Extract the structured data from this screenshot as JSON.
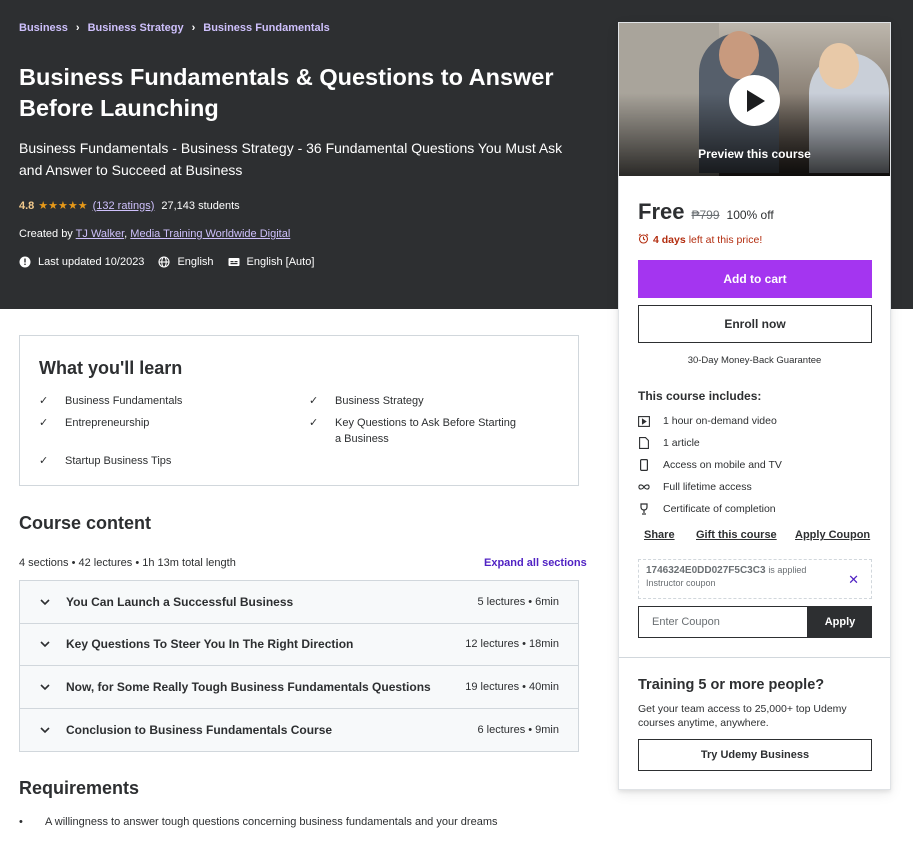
{
  "breadcrumb": [
    "Business",
    "Business Strategy",
    "Business Fundamentals"
  ],
  "course": {
    "title": "Business Fundamentals & Questions to Answer Before Launching",
    "subtitle": "Business Fundamentals - Business Strategy - 36 Fundamental Questions You Must Ask and Answer to Succeed at Business",
    "rating": "4.8",
    "stars": "★★★★★",
    "ratings_link": "(132 ratings)",
    "students": "27,143 students",
    "created_prefix": "Created by",
    "instructor1": "TJ Walker",
    "instructor_sep": ",",
    "instructor2": "Media Training Worldwide Digital",
    "last_updated": "Last updated 10/2023",
    "language": "English",
    "captions": "English [Auto]"
  },
  "learn": {
    "title": "What you'll learn",
    "items": [
      "Business Fundamentals",
      "Business Strategy",
      "Entrepreneurship",
      "Key Questions to Ask Before Starting a Business",
      "Startup Business Tips"
    ]
  },
  "content": {
    "title": "Course content",
    "meta": "4 sections • 42 lectures • 1h 13m total length",
    "expand": "Expand all sections",
    "sections": [
      {
        "name": "You Can Launch a Successful Business",
        "info": "5 lectures • 6min"
      },
      {
        "name": "Key Questions To Steer You In The Right Direction",
        "info": "12 lectures • 18min"
      },
      {
        "name": "Now, for Some Really Tough Business Fundamentals Questions",
        "info": "19 lectures • 40min"
      },
      {
        "name": "Conclusion to Business Fundamentals Course",
        "info": "6 lectures • 9min"
      }
    ]
  },
  "requirements": {
    "title": "Requirements",
    "items": [
      "A willingness to answer tough questions concerning business fundamentals and your dreams"
    ]
  },
  "sidebar": {
    "preview_label": "Preview this course",
    "price": "Free",
    "old_price": "₱799",
    "discount": "100% off",
    "timer_bold": "4 days",
    "timer_rest": "left at this price!",
    "add_to_cart": "Add to cart",
    "enroll": "Enroll now",
    "guarantee": "30-Day Money-Back Guarantee",
    "includes_title": "This course includes:",
    "includes": [
      "1 hour on-demand video",
      "1 article",
      "Access on mobile and TV",
      "Full lifetime access",
      "Certificate of completion"
    ],
    "share": "Share",
    "gift": "Gift this course",
    "apply_coupon": "Apply Coupon",
    "coupon_code": "1746324E0DD027F5C3C3",
    "coupon_applied": "is applied",
    "coupon_type": "Instructor coupon",
    "coupon_placeholder": "Enter Coupon",
    "coupon_apply_btn": "Apply",
    "biz_title": "Training 5 or more people?",
    "biz_text": "Get your team access to 25,000+ top Udemy courses anytime, anywhere.",
    "biz_btn": "Try Udemy Business"
  },
  "colors": {
    "hero_bg": "#2d2f31",
    "accent": "#a435f0",
    "link_purple": "#5022c3",
    "star": "#e59819",
    "timer_red": "#b32d0f"
  }
}
